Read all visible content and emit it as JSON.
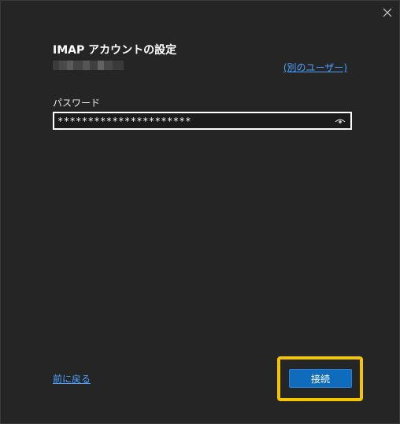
{
  "dialog": {
    "title": "IMAP アカウントの設定",
    "other_user_link": "(別のユーザー)",
    "password_label": "パスワード",
    "password_value": "**********************",
    "back_link": "前に戻る",
    "connect_button": "接続"
  },
  "icons": {
    "close": "close-icon",
    "reveal": "eye-icon"
  },
  "colors": {
    "background": "#252525",
    "link": "#4aa3ff",
    "primary_button": "#0f6cbd",
    "highlight": "#f5c400"
  }
}
